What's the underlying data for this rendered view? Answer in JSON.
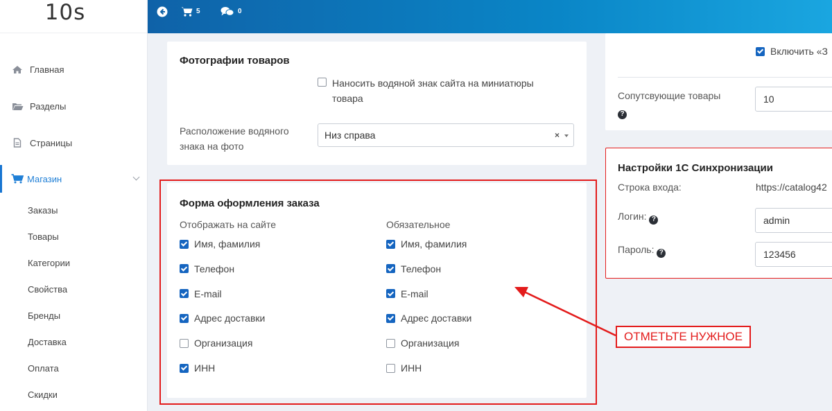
{
  "logo": {
    "text": "10s"
  },
  "topbar": {
    "cart_count": "5",
    "messages_count": "0"
  },
  "sidebar": {
    "items": [
      {
        "label": "Главная",
        "icon": "home-icon"
      },
      {
        "label": "Разделы",
        "icon": "folder-icon"
      },
      {
        "label": "Страницы",
        "icon": "file-icon"
      },
      {
        "label": "Магазин",
        "icon": "cart-icon"
      }
    ],
    "shop_items": [
      "Заказы",
      "Товары",
      "Категории",
      "Свойства",
      "Бренды",
      "Доставка",
      "Оплата",
      "Скидки"
    ]
  },
  "photos": {
    "title": "Фотографии товаров",
    "watermark_line1": "Наносить водяной знак сайта на миниатюры",
    "watermark_line2": "товара",
    "position_label_line1": "Расположение водяного",
    "position_label_line2": "знака на фото",
    "position_value": "Низ справа"
  },
  "order_form": {
    "title": "Форма оформления заказа",
    "col1_header": "Отображать на сайте",
    "col2_header": "Обязательное",
    "show": [
      {
        "label": "Имя, фамилия",
        "checked": true
      },
      {
        "label": "Телефон",
        "checked": true
      },
      {
        "label": "E-mail",
        "checked": true
      },
      {
        "label": "Адрес доставки",
        "checked": true
      },
      {
        "label": "Организация",
        "checked": false
      },
      {
        "label": "ИНН",
        "checked": true
      }
    ],
    "required": [
      {
        "label": "Имя, фамилия",
        "checked": true
      },
      {
        "label": "Телефон",
        "checked": true
      },
      {
        "label": "E-mail",
        "checked": true
      },
      {
        "label": "Адрес доставки",
        "checked": true
      },
      {
        "label": "Организация",
        "checked": false
      },
      {
        "label": "ИНН",
        "checked": false
      }
    ]
  },
  "right_top": {
    "enable_label": "Включить «З",
    "related_label": "Сопутсвующие товары",
    "related_value": "10"
  },
  "sync": {
    "title": "Настройки 1С Синхронизации",
    "url_label": "Строка входа:",
    "url_value": "https://catalog42",
    "login_label": "Логин:",
    "login_value": "admin",
    "password_label": "Пароль:",
    "password_value": "123456"
  },
  "annotation": {
    "text": "ОТМЕТЬТЕ НУЖНОЕ"
  },
  "colors": {
    "accent": "#1565c0",
    "annotation": "#e31b1b",
    "topbar": "#0a86c7"
  }
}
